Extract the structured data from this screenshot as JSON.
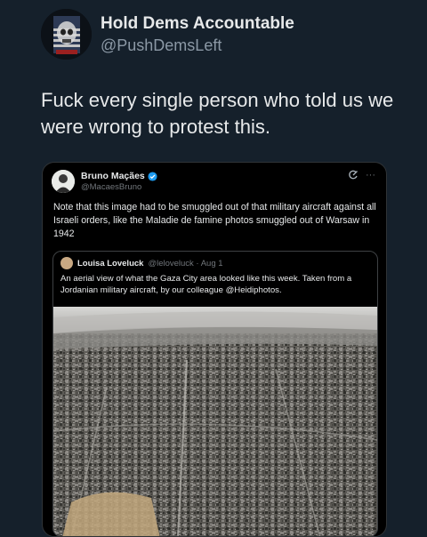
{
  "post": {
    "display_name": "Hold Dems Accountable",
    "handle": "@PushDemsLeft",
    "text": "Fuck every single person who told us we were wrong to protest this."
  },
  "embedded": {
    "display_name": "Bruno Maçães",
    "handle": "@MacaesBruno",
    "text": "Note that this image had to be smuggled out of that military aircraft against all Israeli orders, like the Maladie de famine photos smuggled out of Warsaw in 1942",
    "icons": [
      "grok-icon",
      "more-icon"
    ],
    "more_label": "···"
  },
  "quoted": {
    "display_name": "Louisa Loveluck",
    "handle_date": "@leloveluck · Aug 1",
    "text": "An aerial view of what the Gaza City area looked like this week. Taken from a Jordanian military aircraft, by our colleague @Heidiphotos."
  },
  "colors": {
    "background": "#15202b",
    "verified": "#1d9bf0",
    "card": "#000000"
  }
}
